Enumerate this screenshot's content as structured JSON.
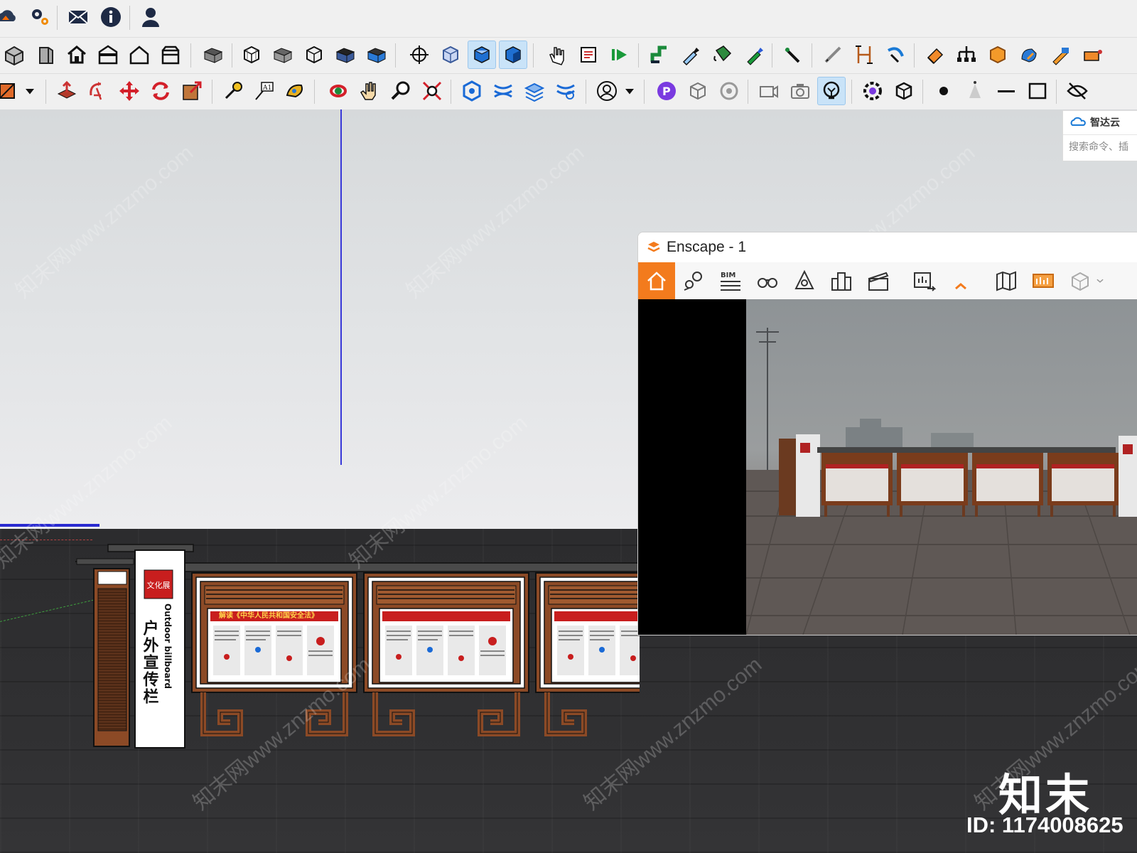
{
  "toolbar": {
    "row0_icons": [
      "cloud-upload-icon",
      "settings-gears-icon",
      "mail-icon",
      "info-icon",
      "user-icon"
    ],
    "row1_icons": [
      "iso-view-icon",
      "front-view-icon",
      "home-view-icon",
      "front-elevation-icon",
      "house-outline-icon",
      "back-view-icon",
      "group-icon",
      "section-plane-icon",
      "component-icon",
      "outliner-icon",
      "shadow-icon",
      "fog-icon",
      "orbit-icon",
      "hidden-line-icon",
      "shaded-icon",
      "textured-icon",
      "hand-select-icon",
      "notes-icon",
      "play-scene-icon",
      "follow-me-icon",
      "eyedropper-icon",
      "paint-bucket-icon",
      "material-picker-icon",
      "brush-icon",
      "line-tool-icon",
      "dimension-icon",
      "arc-arrow-icon",
      "eraser-icon",
      "tree-structure-icon",
      "box-material-icon",
      "shape-icon",
      "pencil-rect-icon",
      "cube-red-icon"
    ],
    "row2_icons": [
      "rectangle-tool-icon",
      "push-pull-icon",
      "rotate-tool-icon",
      "move-tool-icon",
      "refresh-icon",
      "scale-tool-icon",
      "tape-measure-icon",
      "text-label-icon",
      "paint-icon",
      "orbit-tool-icon",
      "pan-tool-icon",
      "zoom-tool-icon",
      "zoom-extents-icon",
      "solid-tools-icon",
      "intersect-icon",
      "layers-icon",
      "trim-icon",
      "user-circle-icon",
      "dropdown-caret-icon",
      "plugin-p-icon",
      "box-view-icon",
      "rotate-view-icon",
      "camera-video-icon",
      "camera-photo-icon",
      "light-bulb-icon",
      "gear-flower-icon",
      "cube-arrow-icon",
      "point-icon",
      "cone-icon",
      "minus-icon",
      "square-icon",
      "eye-hidden-icon"
    ],
    "text_label_glyph": "A1"
  },
  "zhida": {
    "title": "智达云",
    "search_placeholder": "搜索命令、插"
  },
  "enscape": {
    "title": "Enscape - 1",
    "toolbar_label_bim": "BIM"
  },
  "model": {
    "pillar_vertical_text": "户外宣传栏",
    "pillar_english": "Outdoor billboard",
    "pillar_seal": "文化展",
    "panel_headline": "解读《中华人民共和国安全法》"
  },
  "watermark": {
    "site_text": "知末网www.znzmo.com",
    "brand": "知末",
    "id_text": "ID: 1174008625"
  },
  "colors": {
    "accent_orange": "#f37b1d",
    "frame_brown": "#8c4a26",
    "axis_blue": "#3838d8",
    "active_button_bg": "#c9e3f8"
  }
}
